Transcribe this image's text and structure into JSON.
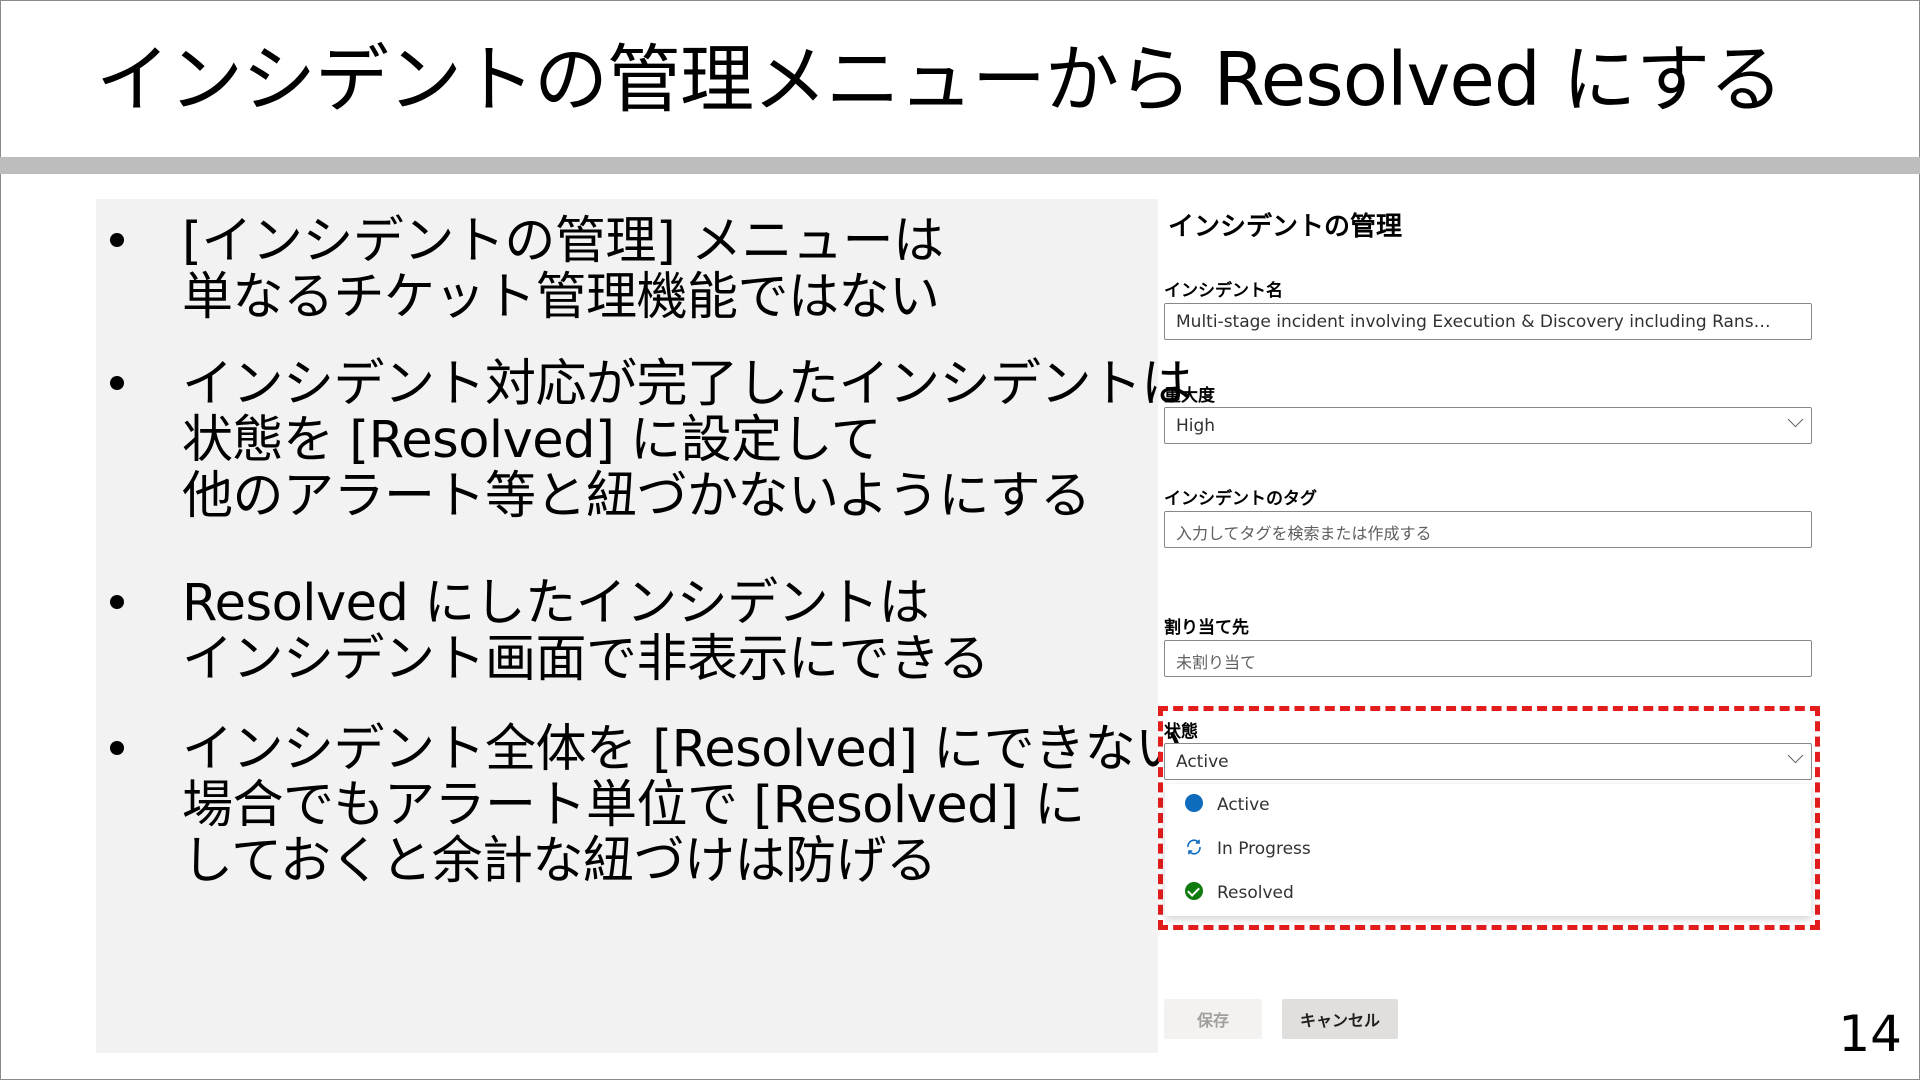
{
  "slide": {
    "title": "インシデントの管理メニューから Resolved にする",
    "page_number": "14"
  },
  "bullets": [
    {
      "lines": [
        "[インシデントの管理] メニューは",
        "単なるチケット管理機能ではない"
      ]
    },
    {
      "lines": [
        "インシデント対応が完了したインシデントは",
        "状態を [Resolved] に設定して",
        "他のアラート等と紐づかないようにする"
      ]
    },
    {
      "lines": [
        "Resolved にしたインシデントは",
        "インシデント画面で非表示にできる"
      ]
    },
    {
      "lines": [
        "インシデント全体を [Resolved] にできない",
        "場合でもアラート単位で [Resolved] に",
        "しておくと余計な紐づけは防げる"
      ]
    }
  ],
  "panel": {
    "title": "インシデントの管理",
    "incident_name": {
      "label": "インシデント名",
      "value": "Multi-stage incident involving Execution & Discovery including Ransomware on ..."
    },
    "severity": {
      "label": "重大度",
      "value": "High"
    },
    "tags": {
      "label": "インシデントのタグ",
      "placeholder": "入力してタグを検索または作成する"
    },
    "assigned_to": {
      "label": "割り当て先",
      "value": "未割り当て"
    },
    "status": {
      "label": "状態",
      "value": "Active",
      "options": [
        {
          "label": "Active",
          "icon": "active-dot-icon",
          "color": "#0f6cbd"
        },
        {
          "label": "In Progress",
          "icon": "in-progress-icon",
          "color": "#0f6cbd"
        },
        {
          "label": "Resolved",
          "icon": "resolved-check-icon",
          "color": "#107c10"
        }
      ]
    },
    "save_label": "保存",
    "cancel_label": "キャンセル"
  },
  "colors": {
    "highlight": "#e31c1c",
    "left_panel_bg": "#f2f2f2",
    "title_rule": "#bdbdbd"
  }
}
